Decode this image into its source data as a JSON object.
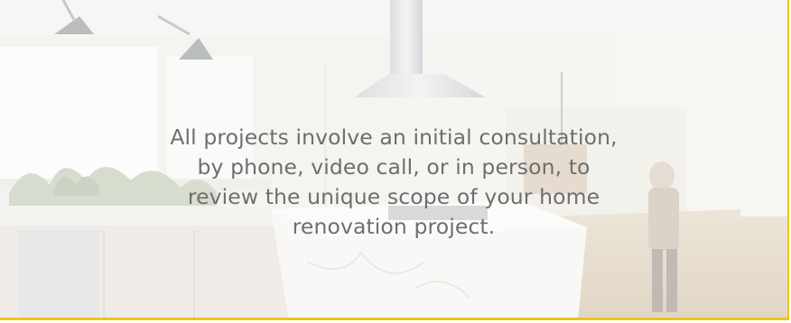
{
  "hero": {
    "message_lines": [
      "All projects involve an initial consultation,",
      "by phone, video call, or in person, to",
      "review the unique scope of your home",
      "renovation project."
    ],
    "accent_border_color": "#f0c419",
    "text_color": "#6e6e6e"
  }
}
